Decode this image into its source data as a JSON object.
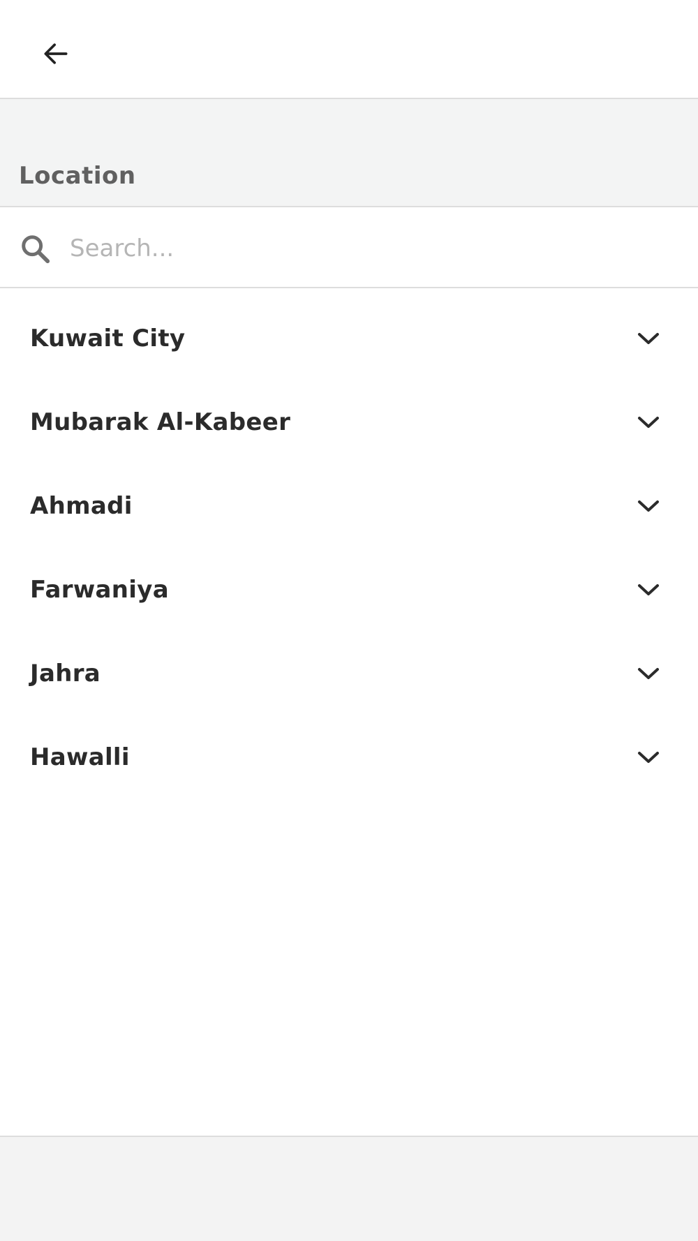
{
  "header": {
    "back_icon": "arrow-left-icon"
  },
  "section": {
    "title": "Location"
  },
  "search": {
    "placeholder": "Search...",
    "value": "",
    "icon": "search-icon"
  },
  "regions": [
    {
      "label": "Kuwait City"
    },
    {
      "label": "Mubarak Al-Kabeer"
    },
    {
      "label": "Ahmadi"
    },
    {
      "label": "Farwaniya"
    },
    {
      "label": "Jahra"
    },
    {
      "label": "Hawalli"
    }
  ],
  "list": {
    "item_icon": "chevron-down-icon"
  }
}
